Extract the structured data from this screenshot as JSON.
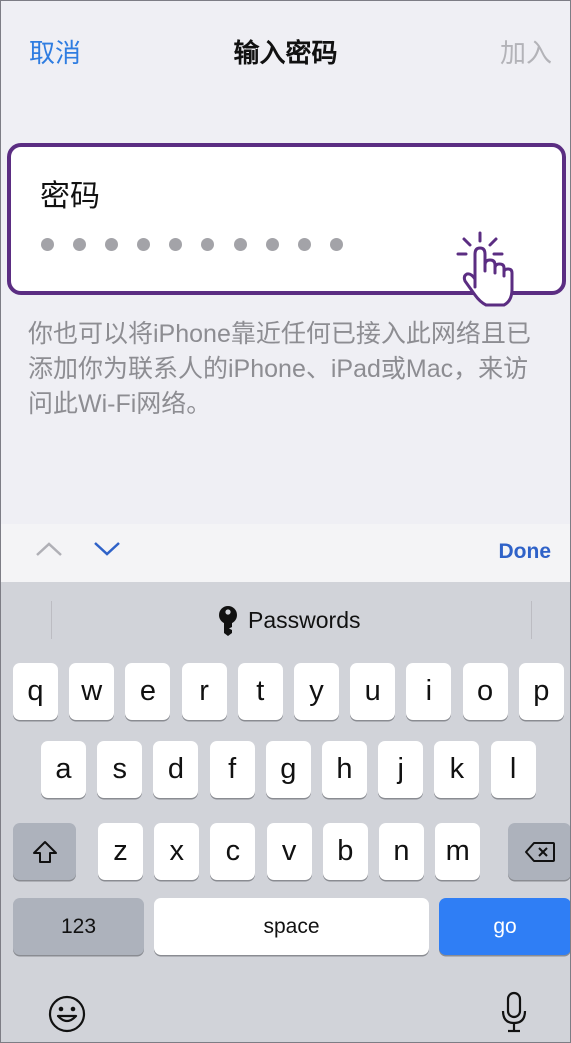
{
  "nav": {
    "cancel": "取消",
    "title": "输入密码",
    "join": "加入"
  },
  "password_field": {
    "label": "密码",
    "dot_count": 10
  },
  "hint": "你也可以将iPhone靠近任何已接入此网络且已添加你为联系人的iPhone、iPad或Mac，来访问此Wi-Fi网络。",
  "accessory": {
    "done": "Done"
  },
  "suggestion": {
    "text": "Passwords"
  },
  "keyboard": {
    "row1": [
      "q",
      "w",
      "e",
      "r",
      "t",
      "y",
      "u",
      "i",
      "o",
      "p"
    ],
    "row2": [
      "a",
      "s",
      "d",
      "f",
      "g",
      "h",
      "j",
      "k",
      "l"
    ],
    "row3": [
      "z",
      "x",
      "c",
      "v",
      "b",
      "n",
      "m"
    ],
    "numbers": "123",
    "space": "space",
    "go": "go"
  },
  "colors": {
    "accent": "#2f7de1",
    "highlight_border": "#5b2d82",
    "go_key": "#2f7ef5"
  }
}
